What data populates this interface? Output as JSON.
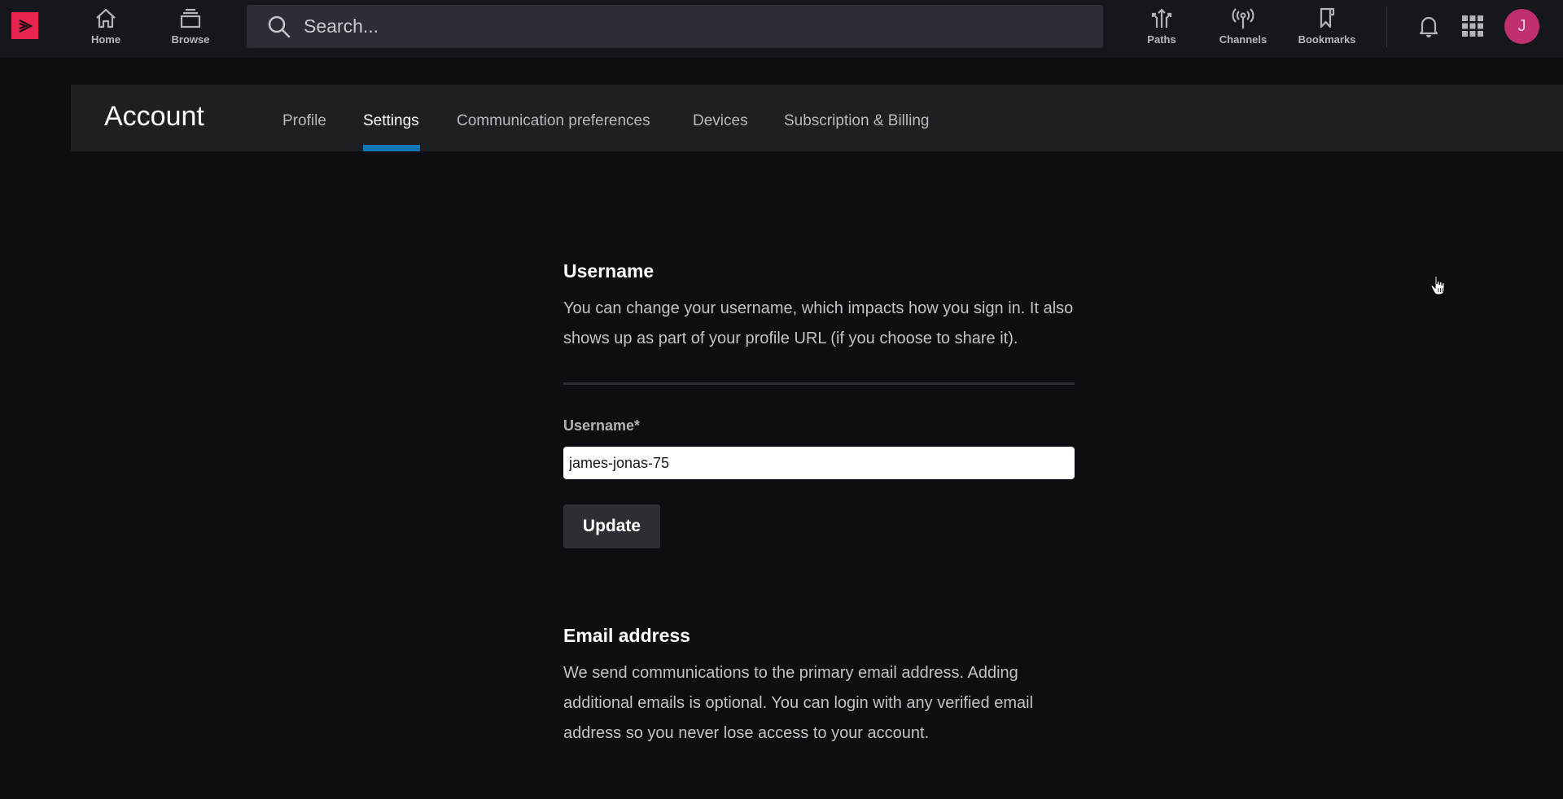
{
  "topnav": {
    "logo_icon": "play-arrow-logo",
    "home_label": "Home",
    "browse_label": "Browse",
    "search_placeholder": "Search...",
    "paths_label": "Paths",
    "channels_label": "Channels",
    "bookmarks_label": "Bookmarks",
    "avatar_initial": "J",
    "colors": {
      "brand": "#e5254d",
      "avatar": "#c0306e"
    }
  },
  "account": {
    "title": "Account",
    "tabs": [
      {
        "label": "Profile",
        "active": false
      },
      {
        "label": "Settings",
        "active": true
      },
      {
        "label": "Communication preferences",
        "active": false
      },
      {
        "label": "Devices",
        "active": false
      },
      {
        "label": "Subscription & Billing",
        "active": false
      }
    ],
    "accent": "#0d78b5"
  },
  "username_section": {
    "title": "Username",
    "description": "You can change your username, which impacts how you sign in. It also shows up as part of your profile URL (if you choose to share it).",
    "field_label": "Username*",
    "field_value": "james-jonas-75",
    "update_label": "Update"
  },
  "email_section": {
    "title": "Email address",
    "description": "We send communications to the primary email address. Adding additional emails is optional. You can login with any verified email address so you never lose access to your account."
  }
}
